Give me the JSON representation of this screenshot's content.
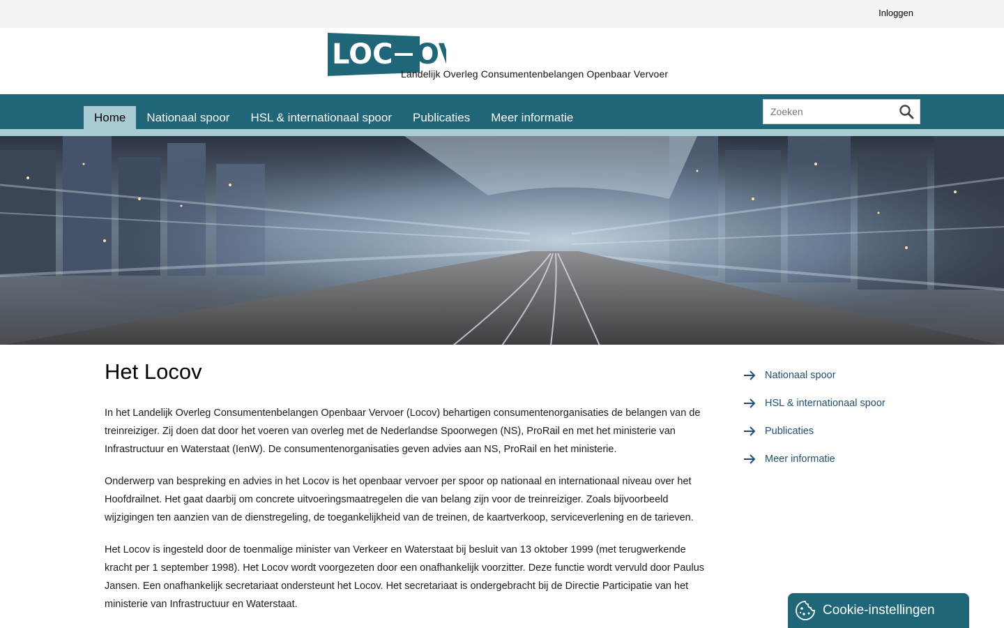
{
  "topbar": {
    "login_label": "Inloggen"
  },
  "logo": {
    "mark": "LOCOV",
    "subtitle": "Landelijk Overleg Consumentenbelangen Openbaar Vervoer"
  },
  "nav": {
    "items": [
      {
        "label": "Home",
        "active": true
      },
      {
        "label": "Nationaal spoor"
      },
      {
        "label": "HSL & internationaal spoor"
      },
      {
        "label": "Publicaties"
      },
      {
        "label": "Meer informatie"
      }
    ]
  },
  "search": {
    "placeholder": "Zoeken"
  },
  "main": {
    "title": "Het Locov",
    "paragraphs": [
      "In het Landelijk Overleg Consumentenbelangen Openbaar Vervoer (Locov) behartigen consumentenorganisaties de belangen van de treinreiziger. Zij doen dat door het voeren van overleg met de Nederlandse Spoorwegen (NS), ProRail en met het ministerie van Infrastructuur en Waterstaat (IenW). De consumentenorganisaties geven advies aan NS, ProRail en het ministerie.",
      "Onderwerp van bespreking en advies in het Locov is het openbaar vervoer per spoor op nationaal en internationaal niveau over het Hoofdrailnet. Het gaat daarbij om concrete uitvoeringsmaatregelen die van belang zijn voor de treinreiziger. Zoals bijvoorbeeld wijzigingen ten aanzien van de dienstregeling, de toegankelijkheid van de treinen, de kaartverkoop, serviceverlening en de tarieven.",
      "Het Locov is ingesteld door de toenmalige minister van Verkeer en Waterstaat bij besluit van 13 oktober 1999 (met terugwerkende kracht per 1 september 1998). Het Locov wordt voorgezeten door een onafhankelijk voorzitter. Deze functie wordt vervuld door Paulus Jansen. Een onafhankelijk secretariaat ondersteunt het Locov. Het secretariaat is ondergebracht bij de Directie Participatie van het ministerie van Infrastructuur en Waterstaat."
    ]
  },
  "sidebar": {
    "links": [
      {
        "label": "Nationaal spoor"
      },
      {
        "label": "HSL & internationaal spoor"
      },
      {
        "label": "Publicaties"
      },
      {
        "label": "Meer informatie"
      }
    ]
  },
  "cookie": {
    "label": "Cookie-instellingen"
  },
  "colors": {
    "brand": "#1f6678",
    "nav_active": "#a9cbd3",
    "link": "#1f4f78",
    "topbar": "#f3f3f3"
  },
  "icons": {
    "search": "search-icon",
    "arrow": "arrow-right-icon",
    "cookie": "cookie-icon"
  }
}
